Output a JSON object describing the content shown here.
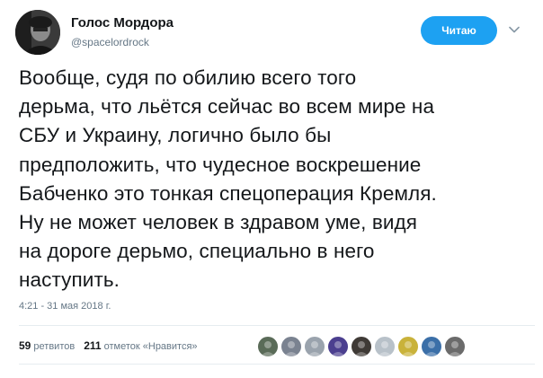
{
  "author": {
    "display_name": "Голос Мордора",
    "handle": "@spacelordrock",
    "avatar_icon": "dark-portrait-avatar"
  },
  "actions": {
    "follow_label": "Читаю",
    "more_icon": "chevron-down-icon",
    "accent_color": "#1da1f2"
  },
  "tweet": {
    "lines": [
      "Вообще, судя по обилию всего того",
      "дерьма, что льётся сейчас во всем мире на",
      "СБУ и Украину, логично было бы",
      "предположить, что чудесное воскрешение",
      "Бабченко это тонкая спецоперация Кремля.",
      "Ну не может человек в здравом уме, видя",
      "на дороге дерьмо, специально в него",
      "наступить."
    ],
    "timestamp": "4:21 - 31 мая 2018 г."
  },
  "stats": {
    "retweets_count": "59",
    "retweets_label": "ретвитов",
    "likes_count": "211",
    "likes_label": "отметок «Нравится»"
  },
  "likers": [
    {
      "icon": "liker-avatar-1",
      "color": "#5a6b58"
    },
    {
      "icon": "liker-avatar-2",
      "color": "#7a8290"
    },
    {
      "icon": "liker-avatar-3",
      "color": "#9aa3ad"
    },
    {
      "icon": "liker-avatar-4",
      "color": "#4b3f8f"
    },
    {
      "icon": "liker-avatar-5",
      "color": "#3f3a36"
    },
    {
      "icon": "liker-avatar-6",
      "color": "#b8c1c9"
    },
    {
      "icon": "liker-avatar-7",
      "color": "#c9b23a"
    },
    {
      "icon": "liker-avatar-8",
      "color": "#3b6fa8"
    },
    {
      "icon": "liker-avatar-9",
      "color": "#6b6b6b"
    }
  ]
}
